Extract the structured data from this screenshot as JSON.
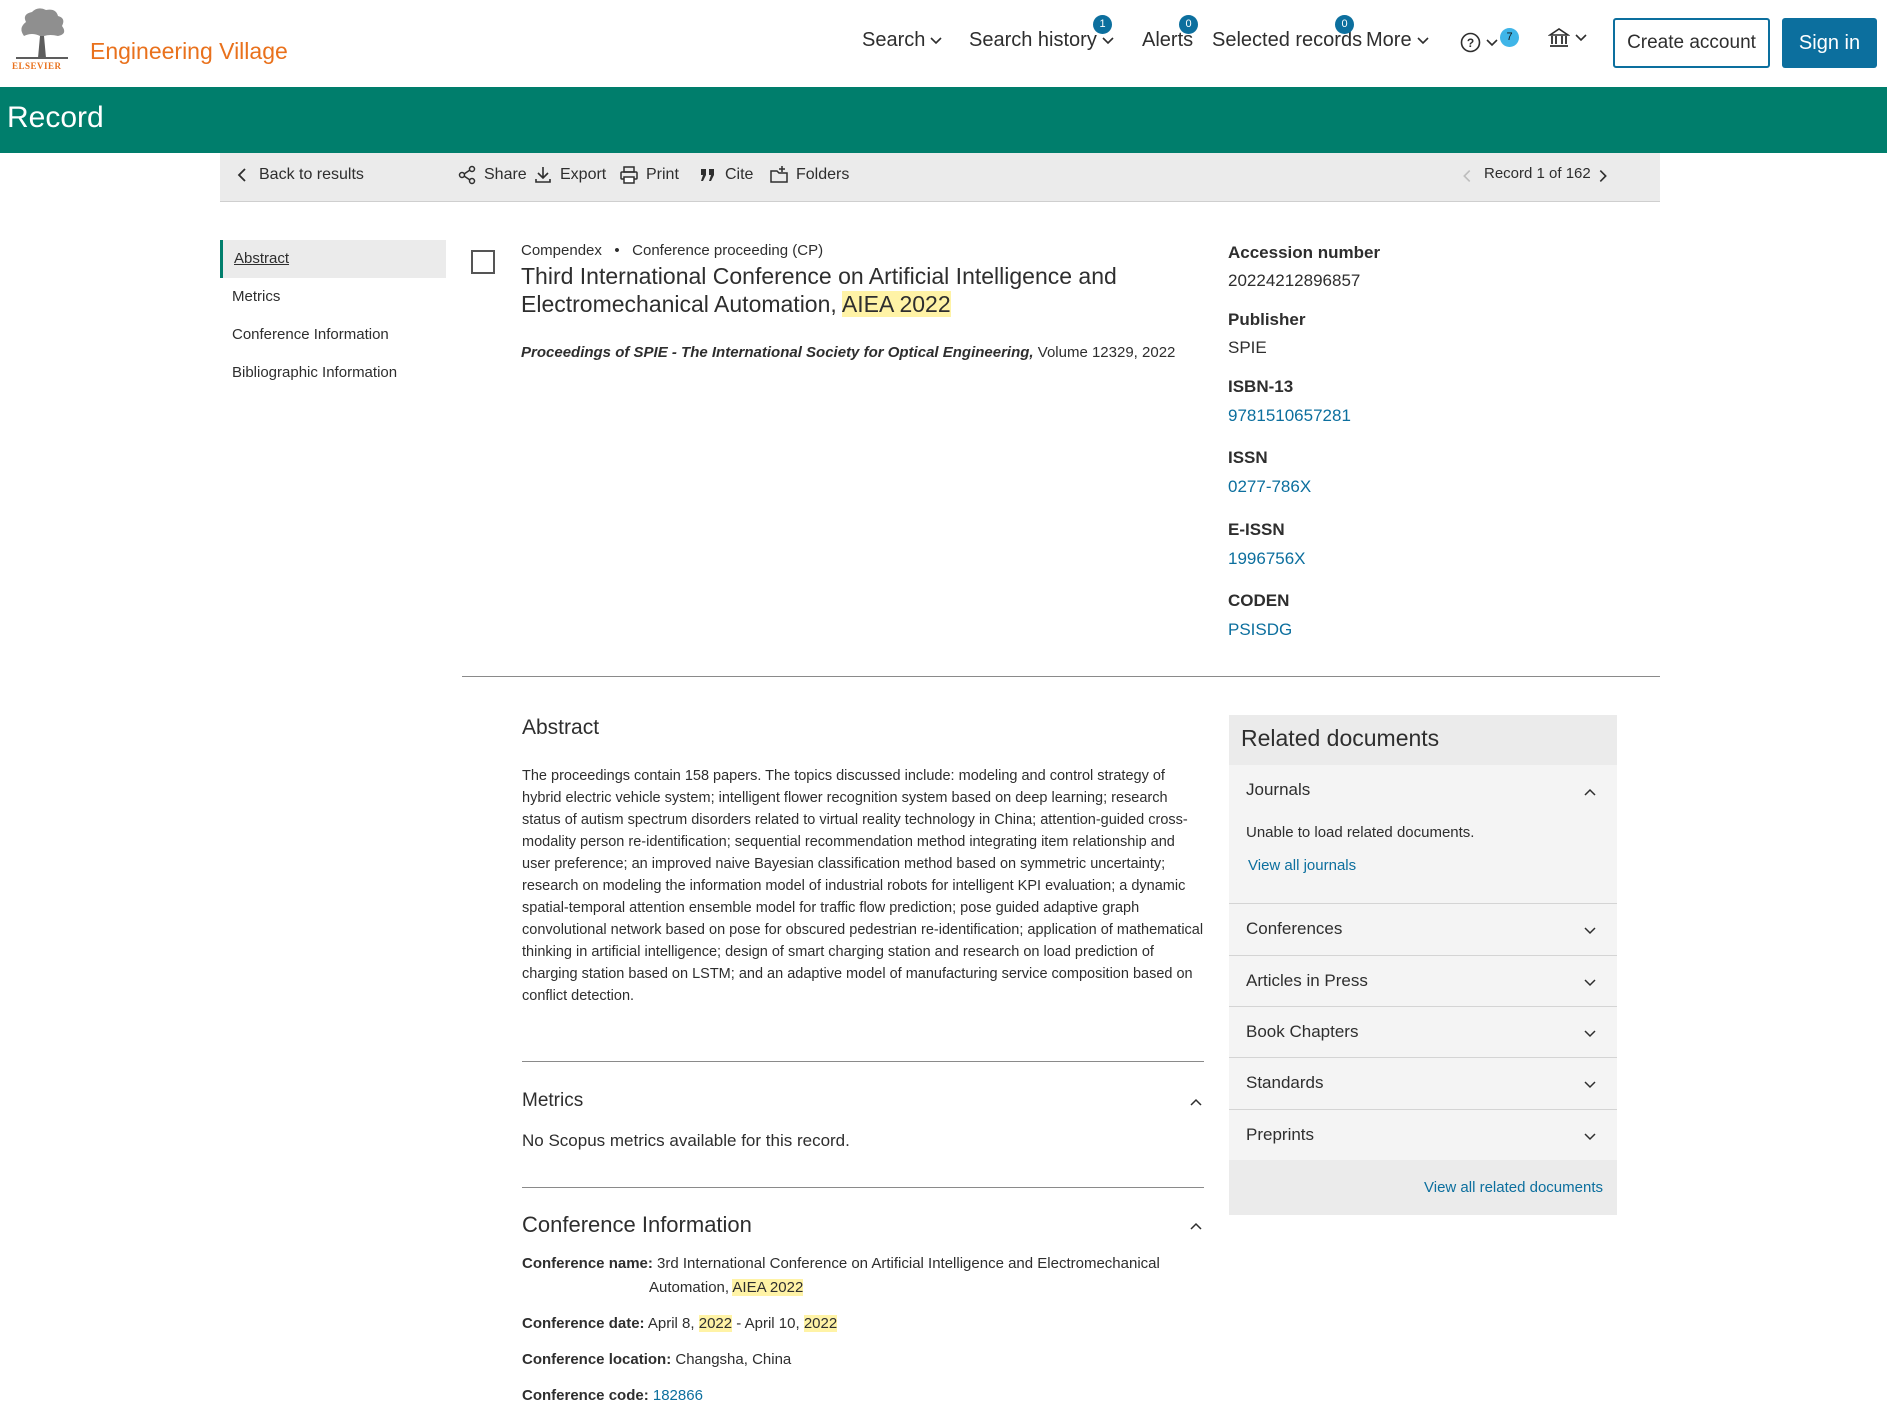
{
  "header": {
    "brand_small": "ELSEVIER",
    "brand": "Engineering Village",
    "nav": {
      "search": "Search",
      "search_history": "Search history",
      "search_history_badge": "1",
      "alerts": "Alerts",
      "alerts_badge": "0",
      "selected_records": "Selected records",
      "selected_records_badge": "0",
      "more": "More",
      "help_badge": "7"
    },
    "create_account": "Create account",
    "sign_in": "Sign in"
  },
  "banner": {
    "title": "Record"
  },
  "toolbar": {
    "back": "Back to results",
    "share": "Share",
    "export": "Export",
    "print": "Print",
    "cite": "Cite",
    "folders": "Folders",
    "record_position": "Record 1 of 162"
  },
  "sidenav": {
    "items": [
      "Abstract",
      "Metrics",
      "Conference Information",
      "Bibliographic Information"
    ]
  },
  "record": {
    "database": "Compendex",
    "doc_type": "Conference proceeding (CP)",
    "title_part1": "Third International Conference on Artificial Intelligence and Electromechanical Automation, ",
    "title_highlight": "AIEA 2022",
    "source_title": "Proceedings of SPIE - The International Society for Optical Engineering,",
    "source_rest": " Volume 12329, 2022"
  },
  "details": {
    "accession_label": "Accession number",
    "accession_value": "20224212896857",
    "publisher_label": "Publisher",
    "publisher_value": "SPIE",
    "isbn_label": "ISBN-13",
    "isbn_value": "9781510657281",
    "issn_label": "ISSN",
    "issn_value": "0277-786X",
    "eissn_label": "E-ISSN",
    "eissn_value": "1996756X",
    "coden_label": "CODEN",
    "coden_value": "PSISDG"
  },
  "abstract": {
    "heading": "Abstract",
    "text": "The proceedings contain 158 papers. The topics discussed include: modeling and control strategy of hybrid electric vehicle system; intelligent flower recognition system based on deep learning; research status of autism spectrum disorders related to virtual reality technology in China; attention-guided cross-modality person re-identification; sequential recommendation method integrating item relationship and user preference; an improved naive Bayesian classification method based on symmetric uncertainty; research on modeling the information model of industrial robots for intelligent KPI evaluation; a dynamic spatial-temporal attention ensemble model for traffic flow prediction; pose guided adaptive graph convolutional network based on pose for obscured pedestrian re-identification; application of mathematical thinking in artificial intelligence; design of smart charging station and research on load prediction of charging station based on LSTM; and an adaptive model of manufacturing service composition based on conflict detection."
  },
  "metrics": {
    "heading": "Metrics",
    "text": "No Scopus metrics available for this record."
  },
  "conference": {
    "heading": "Conference Information",
    "name_label": "Conference name:",
    "name_part1": "3rd International Conference on Artificial Intelligence and Electromechanical",
    "name_part2": "Automation, ",
    "name_highlight": "AIEA 2022",
    "date_label": "Conference date:",
    "date_part1": "April 8, ",
    "date_year1": "2022",
    "date_part2": " - April 10, ",
    "date_year2": "2022",
    "location_label": "Conference location:",
    "location_value": "Changsha, China",
    "code_label": "Conference code:",
    "code_value": "182866"
  },
  "related": {
    "heading": "Related documents",
    "journals": "Journals",
    "journals_msg": "Unable to load related documents.",
    "view_all_journals": "View all journals",
    "conferences": "Conferences",
    "articles_in_press": "Articles in Press",
    "book_chapters": "Book Chapters",
    "standards": "Standards",
    "preprints": "Preprints",
    "view_all": "View all related documents"
  },
  "colors": {
    "brand_orange": "#e9711c",
    "banner_green": "#007e6c",
    "link_blue": "#0c6f9e",
    "highlight": "#fff3a6"
  }
}
